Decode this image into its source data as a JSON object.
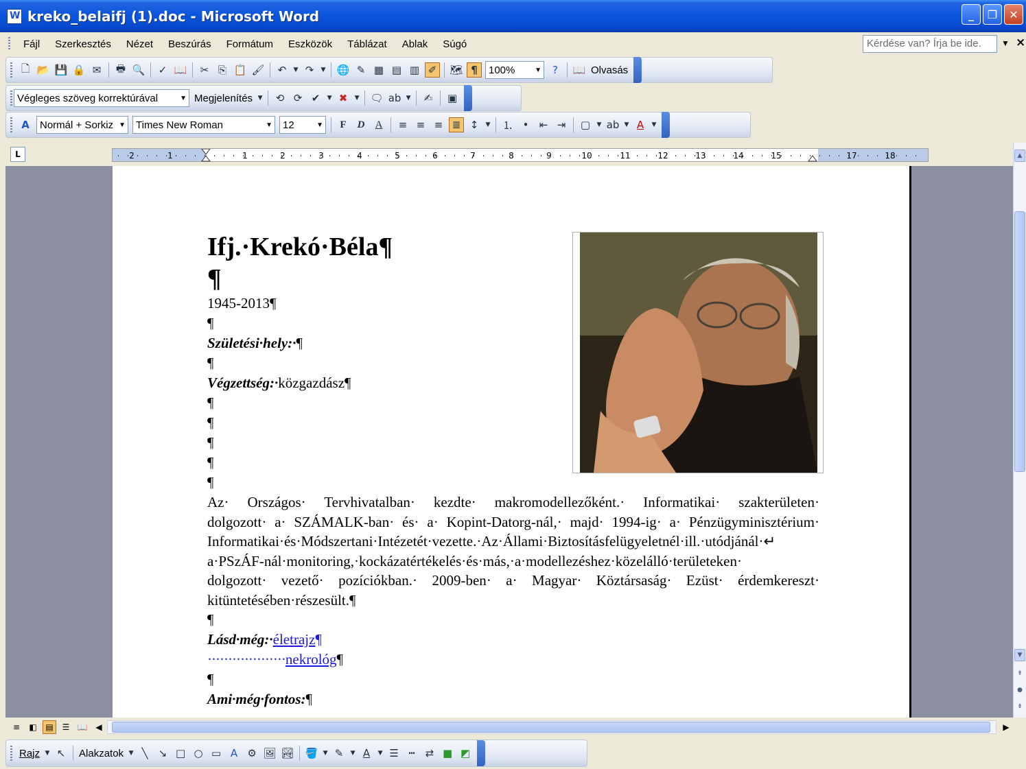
{
  "window": {
    "title": "kreko_belaifj (1).doc - Microsoft Word"
  },
  "menu": [
    "Fájl",
    "Szerkesztés",
    "Nézet",
    "Beszúrás",
    "Formátum",
    "Eszközök",
    "Táblázat",
    "Ablak",
    "Súgó"
  ],
  "help_box": {
    "placeholder": "Kérdése van? Írja be ide."
  },
  "standard_toolbar": {
    "zoom": "100%",
    "read_label": "Olvasás"
  },
  "review_toolbar": {
    "display_mode": "Végleges szöveg korrektúrával",
    "show_label": "Megjelenítés"
  },
  "format_toolbar": {
    "style": "Normál + Sorkiz",
    "font": "Times New Roman",
    "size": "12"
  },
  "ruler": {
    "labels": [
      "2",
      "1",
      "1",
      "2",
      "3",
      "4",
      "5",
      "6",
      "7",
      "8",
      "9",
      "10",
      "11",
      "12",
      "13",
      "14",
      "15",
      "17",
      "18"
    ]
  },
  "document": {
    "heading_name": "Ifj.·Krekó·Béla",
    "pilcrow": "¶",
    "years": "1945-2013",
    "birthplace_label": "Születési·hely:·",
    "education_label": "Végzettség:·",
    "education_value": "közgazdász",
    "bio_lines": [
      "Az· Országos· Tervhivatalban· kezdte· makromodellezőként.· Informatikai· szakterületen·",
      "dolgozott· a· SZÁMALK-ban· és· a· Kopint-Datorg-nál,· majd· 1994-ig· a· Pénzügyminisztérium·",
      "Informatikai·és·Módszertani·Intézetét·vezette.·Az·Állami·Biztosításfelügyeletnél·ill.·utódjánál·↵",
      "a·PSzÁF-nál·monitoring,·kockázatértékelés·és·más,·a·modellezéshez·közelálló·területeken·",
      "dolgozott· vezető· pozíciókban.· 2009-ben· a· Magyar· Köztársaság· Ezüst· érdemkereszt·",
      "kitüntetésében·részesült."
    ],
    "see_also_label": "Lásd·még:·",
    "link_bio": "életrajz",
    "tab_leader": "···················",
    "link_obit": "nekrológ",
    "important_label": "Ami·még·fontos:"
  },
  "drawing_toolbar": {
    "draw_label": "Rajz",
    "shapes_label": "Alakzatok"
  },
  "colors": {
    "title_bar": "#0a55dc",
    "accent_link": "#1a1ad8",
    "misspelling": "#e01919"
  }
}
